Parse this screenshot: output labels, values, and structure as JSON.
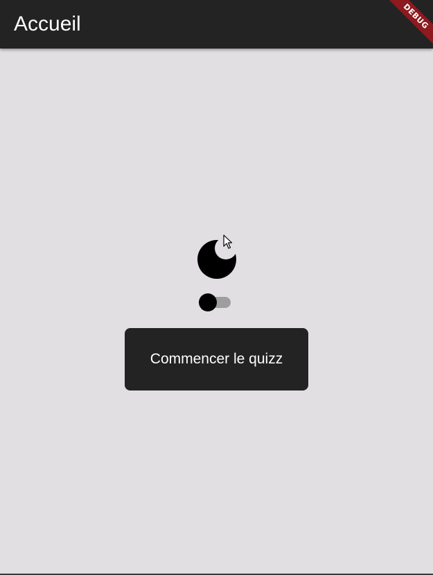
{
  "app_bar": {
    "title": "Accueil"
  },
  "debug_banner": {
    "label": "DEBUG",
    "color": "#8c1a1f"
  },
  "theme_toggle": {
    "icon": "moon-icon",
    "enabled": false
  },
  "start_button": {
    "label": "Commencer le quizz"
  },
  "colors": {
    "app_bar": "#232323",
    "background": "#e1dfe1",
    "button": "#232323",
    "button_text": "#ffffff",
    "toggle_track": "#9e9e9e",
    "toggle_thumb": "#000000"
  }
}
